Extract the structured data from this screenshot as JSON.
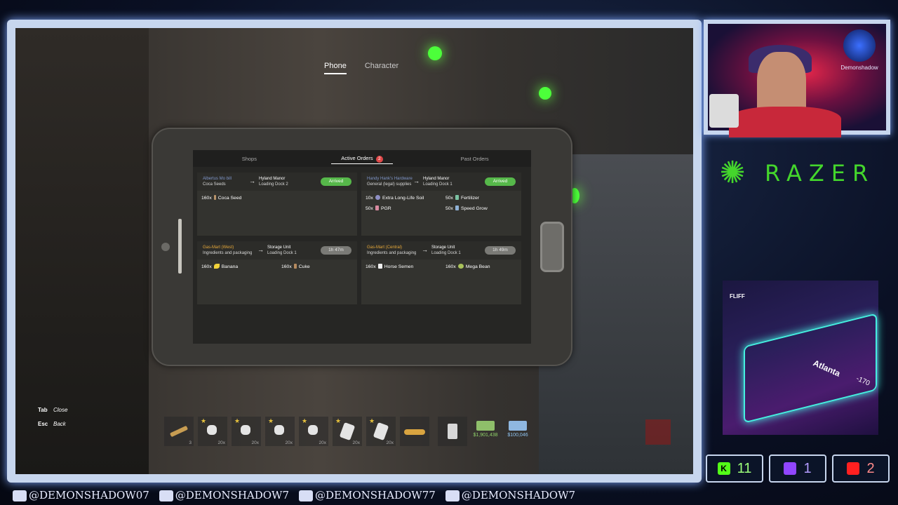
{
  "top_tabs": [
    "Phone",
    "Character"
  ],
  "phone": {
    "tabs": {
      "shops": "Shops",
      "active": "Active Orders",
      "active_count": "2",
      "past": "Past Orders"
    },
    "orders": [
      {
        "source": "Albertus Mo bill",
        "source_sub": "Coca Seeds",
        "dest": "Hyland Manor",
        "dest_sub": "Loading Dock 2",
        "status": "Arrived",
        "items": [
          {
            "qty": "160x",
            "name": "Coca Seed"
          }
        ]
      },
      {
        "source": "Handy Hank's Hardware",
        "source_sub": "General (legal) supplies",
        "dest": "Hyland Manor",
        "dest_sub": "Loading Dock 1",
        "status": "Arrived",
        "items": [
          {
            "qty": "10x",
            "name": "Extra Long-Life Soil"
          },
          {
            "qty": "50x",
            "name": "Fertilizer"
          },
          {
            "qty": "50x",
            "name": "PGR"
          },
          {
            "qty": "50x",
            "name": "Speed Grow"
          }
        ]
      },
      {
        "source": "Gas-Mart (West)",
        "source_sub": "Ingredients and packaging",
        "dest": "Storage Unit",
        "dest_sub": "Loading Dock 1",
        "status": "1h 47m",
        "items": [
          {
            "qty": "160x",
            "name": "Banana"
          },
          {
            "qty": "160x",
            "name": "Cuke"
          }
        ]
      },
      {
        "source": "Gas-Mart (Central)",
        "source_sub": "Ingredients and packaging",
        "dest": "Storage Unit",
        "dest_sub": "Loading Dock 1",
        "status": "1h 49m",
        "items": [
          {
            "qty": "160x",
            "name": "Horse Semen"
          },
          {
            "qty": "160x",
            "name": "Mega Bean"
          }
        ]
      }
    ]
  },
  "key_hints": [
    {
      "key": "Tab",
      "action": "Close"
    },
    {
      "key": "Esc",
      "action": "Back"
    }
  ],
  "hotbar": {
    "slots": [
      {
        "count": "3",
        "starred": false
      },
      {
        "count": "20x",
        "starred": true
      },
      {
        "count": "20x",
        "starred": true
      },
      {
        "count": "20x",
        "starred": true
      },
      {
        "count": "20x",
        "starred": true
      },
      {
        "count": "20x",
        "starred": true
      },
      {
        "count": "20x",
        "starred": true
      },
      {
        "count": "",
        "starred": false
      },
      {
        "count": "",
        "starred": false
      }
    ],
    "cash": "$1,901,438",
    "bank": "$100,046"
  },
  "overlay": {
    "streamer_logo": "Demonshadow",
    "sponsor": "RAZER",
    "ad_brand": "FLIFF",
    "ad_team": "Atlanta",
    "ad_odds": "-170",
    "counters": [
      {
        "icon": "K",
        "value": "11"
      },
      {
        "icon": "twitch",
        "value": "1"
      },
      {
        "icon": "youtube",
        "value": "2"
      }
    ],
    "socials": [
      "@DEMONSHADOW07",
      "@DEMONSHADOW7",
      "@DEMONSHADOW77",
      "@DEMONSHADOW7"
    ]
  },
  "colors": {
    "accent_green": "#56b84a",
    "vendor_orange": "#e7a93a",
    "razer_green": "#44d62c",
    "badge_red": "#e04848"
  }
}
